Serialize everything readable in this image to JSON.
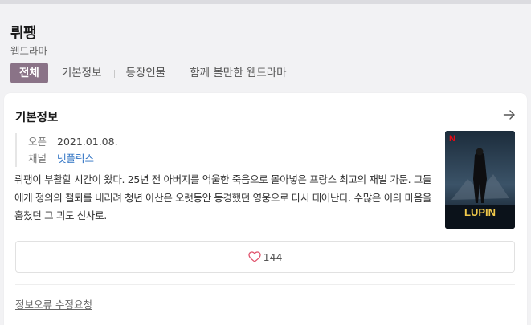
{
  "header": {
    "title": "뤼팽",
    "genre": "웹드라마"
  },
  "tabs": [
    {
      "label": "전체",
      "active": true
    },
    {
      "label": "기본정보",
      "active": false
    },
    {
      "label": "등장인물",
      "active": false
    },
    {
      "label": "함께 볼만한 웹드라마",
      "active": false
    }
  ],
  "info": {
    "section_title": "기본정보",
    "open_label": "오픈",
    "open_value": "2021.01.08.",
    "channel_label": "채널",
    "channel_value": "넷플릭스",
    "description": "뤼팽이 부활할 시간이 왔다. 25년 전 아버지를 억울한 죽음으로 몰아넣은 프랑스 최고의 재벌 가문. 그들에게 정의의 철퇴를 내리려 청년 아산은 오랫동안 동경했던 영웅으로 다시 태어난다. 수많은 이의 마음을 훔쳤던 그 괴도 신사로.",
    "poster": {
      "brand_mark": "N",
      "logo_text": "LUPIN"
    },
    "like_count": "144",
    "report_label": "정보오류 수정요청"
  },
  "colors": {
    "active_tab": "#8a7387",
    "link": "#2a6fc2",
    "heart": "#e0506a"
  },
  "icons": [
    "arrow-right-icon",
    "heart-icon"
  ]
}
